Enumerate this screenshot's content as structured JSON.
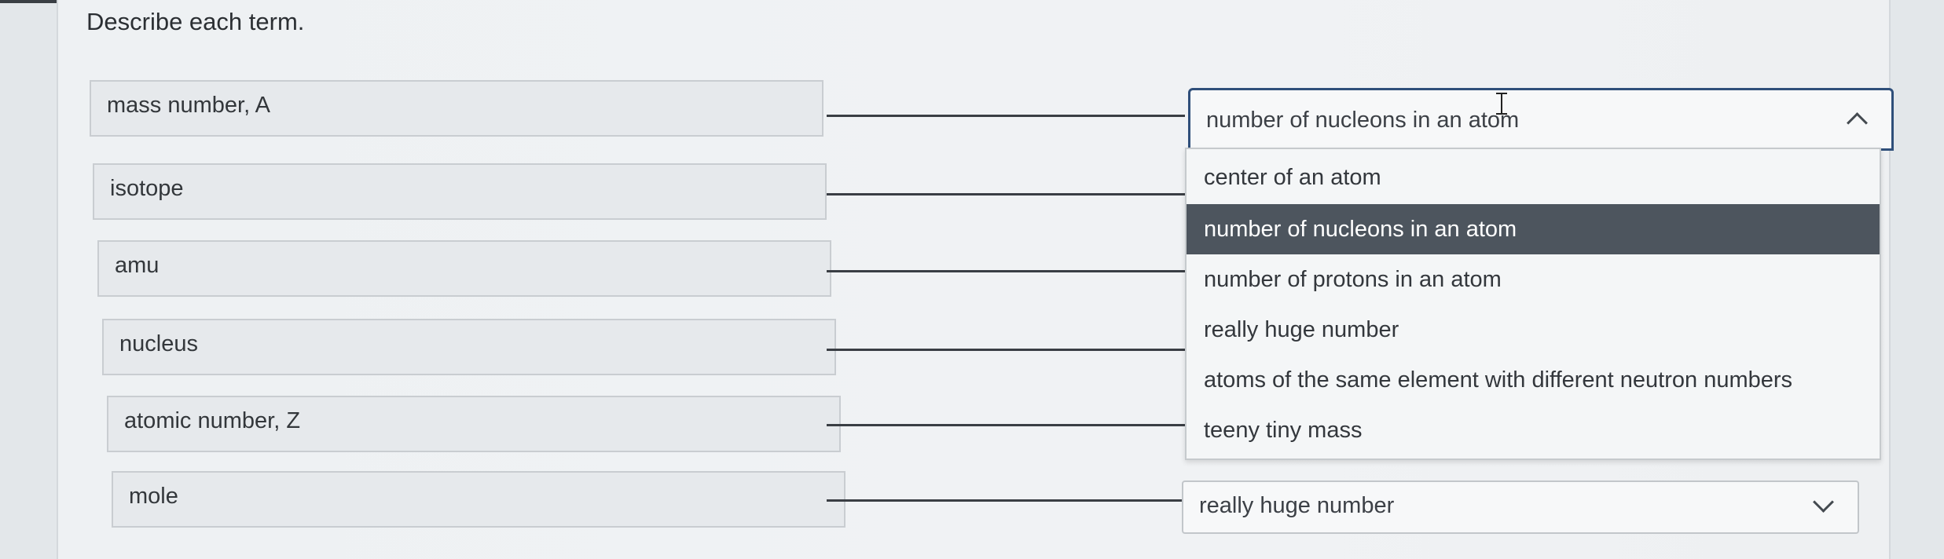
{
  "prompt": "Describe each term.",
  "terms": [
    {
      "label": "mass number, A"
    },
    {
      "label": "isotope"
    },
    {
      "label": "amu"
    },
    {
      "label": "nucleus"
    },
    {
      "label": "atomic number, Z"
    },
    {
      "label": "mole"
    }
  ],
  "open_select": {
    "value": "number of nucleons in an atom",
    "options": [
      "center of an atom",
      "number of nucleons in an atom",
      "number of protons in an atom",
      "really huge number",
      "atoms of the same element with different neutron numbers",
      "teeny tiny mass"
    ],
    "highlighted_index": 1
  },
  "last_select": {
    "value": "really huge number"
  },
  "icons": {
    "open_chevron": "chevron-up-icon",
    "closed_chevron": "chevron-down-icon",
    "cursor": "text-cursor-icon"
  },
  "colors": {
    "highlight": "#4d555e",
    "focus_border": "#2f4f7a"
  }
}
